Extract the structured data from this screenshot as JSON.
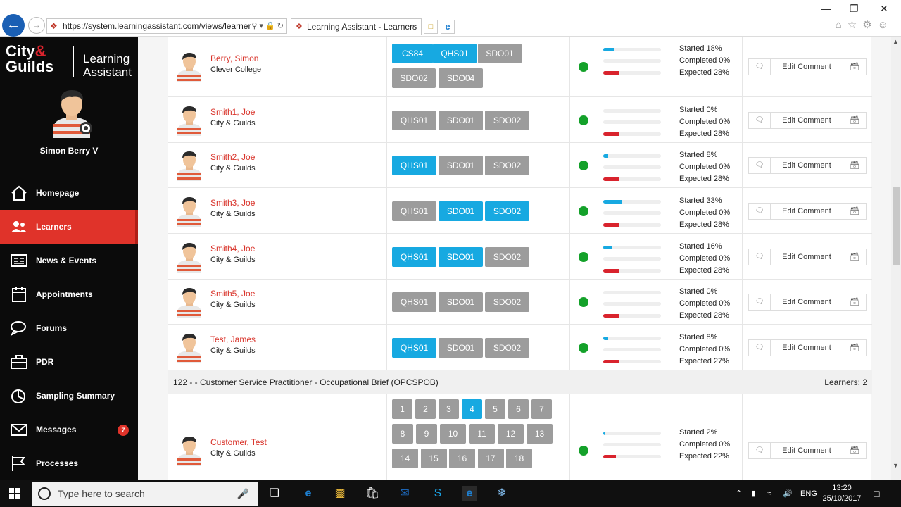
{
  "browser": {
    "url": "https://system.learningassistant.com/views/learner",
    "tab_title": "Learning Assistant - Learners"
  },
  "sidebar": {
    "brand_left": "City & Guilds",
    "brand_right": "Learning Assistant",
    "user_name": "Simon Berry V",
    "items": [
      {
        "label": "Homepage",
        "icon": "home-icon"
      },
      {
        "label": "Learners",
        "icon": "learners-icon",
        "active": true
      },
      {
        "label": "News & Events",
        "icon": "news-icon"
      },
      {
        "label": "Appointments",
        "icon": "calendar-icon"
      },
      {
        "label": "Forums",
        "icon": "forum-icon"
      },
      {
        "label": "PDR",
        "icon": "briefcase-icon"
      },
      {
        "label": "Sampling Summary",
        "icon": "pie-icon"
      },
      {
        "label": "Messages",
        "icon": "mail-icon",
        "badge": "7"
      },
      {
        "label": "Processes",
        "icon": "flag-icon"
      }
    ]
  },
  "learners": [
    {
      "name": "Berry, Simon",
      "org": "Clever College",
      "chips": [
        {
          "label": "CS84",
          "on": true
        },
        {
          "label": "QHS01",
          "on": true
        },
        {
          "label": "SDO01",
          "on": false
        },
        {
          "label": "SDO02",
          "on": false
        },
        {
          "label": "SDO04",
          "on": false
        }
      ],
      "started": "Started 18%",
      "completed": "Completed 0%",
      "expected": "Expected 28%",
      "started_pct": 18,
      "expected_pct": 28
    },
    {
      "name": "Smith1, Joe",
      "org": "City & Guilds",
      "chips": [
        {
          "label": "QHS01",
          "on": false
        },
        {
          "label": "SDO01",
          "on": false
        },
        {
          "label": "SDO02",
          "on": false
        }
      ],
      "started": "Started 0%",
      "completed": "Completed 0%",
      "expected": "Expected 28%",
      "started_pct": 0,
      "expected_pct": 28
    },
    {
      "name": "Smith2, Joe",
      "org": "City & Guilds",
      "chips": [
        {
          "label": "QHS01",
          "on": true
        },
        {
          "label": "SDO01",
          "on": false
        },
        {
          "label": "SDO02",
          "on": false
        }
      ],
      "started": "Started 8%",
      "completed": "Completed 0%",
      "expected": "Expected 28%",
      "started_pct": 8,
      "expected_pct": 28
    },
    {
      "name": "Smith3, Joe",
      "org": "City & Guilds",
      "chips": [
        {
          "label": "QHS01",
          "on": false
        },
        {
          "label": "SDO01",
          "on": true
        },
        {
          "label": "SDO02",
          "on": true
        }
      ],
      "started": "Started 33%",
      "completed": "Completed 0%",
      "expected": "Expected 28%",
      "started_pct": 33,
      "expected_pct": 28
    },
    {
      "name": "Smith4, Joe",
      "org": "City & Guilds",
      "chips": [
        {
          "label": "QHS01",
          "on": true
        },
        {
          "label": "SDO01",
          "on": true
        },
        {
          "label": "SDO02",
          "on": false
        }
      ],
      "started": "Started 16%",
      "completed": "Completed 0%",
      "expected": "Expected 28%",
      "started_pct": 16,
      "expected_pct": 28
    },
    {
      "name": "Smith5, Joe",
      "org": "City & Guilds",
      "chips": [
        {
          "label": "QHS01",
          "on": false
        },
        {
          "label": "SDO01",
          "on": false
        },
        {
          "label": "SDO02",
          "on": false
        }
      ],
      "started": "Started 0%",
      "completed": "Completed 0%",
      "expected": "Expected 28%",
      "started_pct": 0,
      "expected_pct": 28
    },
    {
      "name": "Test, James",
      "org": "City & Guilds",
      "chips": [
        {
          "label": "QHS01",
          "on": true
        },
        {
          "label": "SDO01",
          "on": false
        },
        {
          "label": "SDO02",
          "on": false
        }
      ],
      "started": "Started 8%",
      "completed": "Completed 0%",
      "expected": "Expected 27%",
      "started_pct": 8,
      "expected_pct": 27
    }
  ],
  "group2": {
    "title": "122 - - Customer Service Practitioner - Occupational Brief (OPCSPOB)",
    "count": "Learners: 2",
    "learner": {
      "name": "Customer, Test",
      "org": "City & Guilds",
      "chips": [
        {
          "label": "1",
          "on": false
        },
        {
          "label": "2",
          "on": false
        },
        {
          "label": "3",
          "on": false
        },
        {
          "label": "4",
          "on": true
        },
        {
          "label": "5",
          "on": false
        },
        {
          "label": "6",
          "on": false
        },
        {
          "label": "7",
          "on": false
        },
        {
          "label": "8",
          "on": false
        },
        {
          "label": "9",
          "on": false
        },
        {
          "label": "10",
          "on": false
        },
        {
          "label": "11",
          "on": false
        },
        {
          "label": "12",
          "on": false
        },
        {
          "label": "13",
          "on": false
        },
        {
          "label": "14",
          "on": false
        },
        {
          "label": "15",
          "on": false
        },
        {
          "label": "16",
          "on": false
        },
        {
          "label": "17",
          "on": false
        },
        {
          "label": "18",
          "on": false
        }
      ],
      "started": "Started 2%",
      "completed": "Completed 0%",
      "expected": "Expected 22%",
      "started_pct": 2,
      "expected_pct": 22
    }
  },
  "comment_button": "Edit Comment",
  "taskbar": {
    "search_placeholder": "Type here to search",
    "language": "ENG",
    "time": "13:20",
    "date": "25/10/2017"
  },
  "colors": {
    "accent_red": "#e0332a",
    "chip_blue": "#17a9e1",
    "chip_gray": "#9c9c9c",
    "status_green": "#14a12a"
  }
}
